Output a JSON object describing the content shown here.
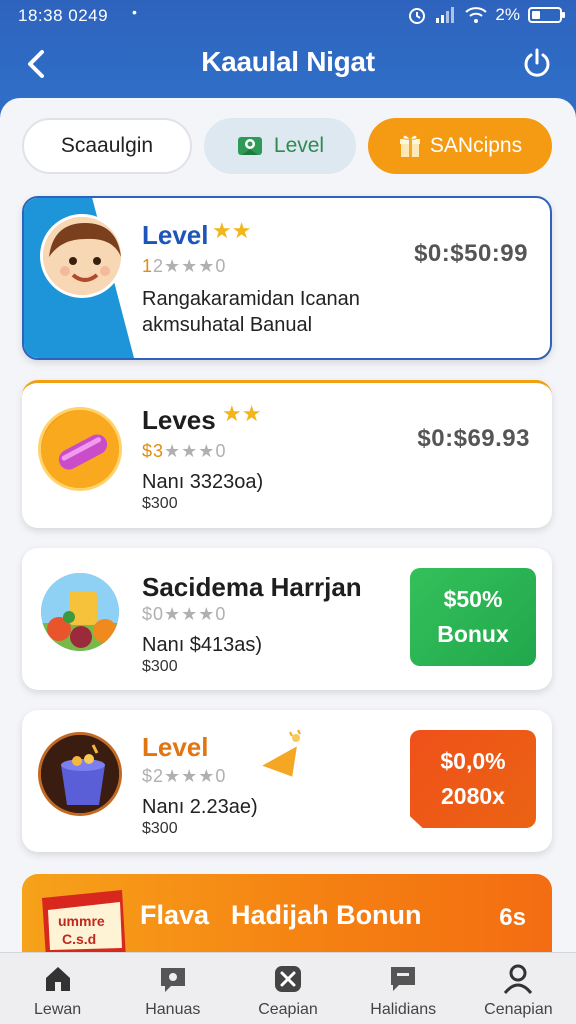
{
  "status_bar": {
    "time": "18:38 0249",
    "dot": "•",
    "battery_percent": "2%",
    "battery_level": 0.3
  },
  "header": {
    "title": "Kaaulal Nigat"
  },
  "chips": [
    {
      "label": "Scaaulgin",
      "selected": true
    },
    {
      "label": "Level",
      "icon": "map-pin-icon"
    },
    {
      "label": "SANcipns",
      "icon": "gift-icon"
    }
  ],
  "cards": [
    {
      "title": "Level",
      "rating_number": "1",
      "rating_text": "2★★★0",
      "price": "$0:$50:99",
      "desc_line1": "Rangakaramidan Icanan",
      "desc_line2": "akmsuhatal Banual",
      "stars": 2
    },
    {
      "title": "Leves",
      "rating_number": "$3",
      "rating_text": "★★★0",
      "price": "$0:$69.93",
      "sub1": "Nanı 3323oa)",
      "sub2": "$300",
      "stars": 2
    },
    {
      "title": "Sacidema Harrjan",
      "rating_text": "$0★★★0",
      "sub1": "Nanı $413as)",
      "sub2": "$300",
      "badge_line1": "$50%",
      "badge_line2": "Bonux"
    },
    {
      "title": "Level",
      "rating_text": "$2★★★0",
      "sub1": "Nanı 2.23ae)",
      "sub2": "$300",
      "badge_line1": "$0,0%",
      "badge_line2": "2080x"
    }
  ],
  "promo": {
    "box_text1": "ummre",
    "box_text2": "C.s.d",
    "text_left": "Flava",
    "text_right": "Hadijah Bonun",
    "count": "6s"
  },
  "bottom_nav": [
    {
      "label": "Lewan",
      "icon": "home-icon"
    },
    {
      "label": "Hanuas",
      "icon": "chat-icon"
    },
    {
      "label": "Ceapian",
      "icon": "shuffle-icon"
    },
    {
      "label": "Halidians",
      "icon": "message-icon"
    },
    {
      "label": "Cenapian",
      "icon": "profile-icon"
    }
  ],
  "colors": {
    "primary": "#2e63bd",
    "accent": "#f59a13",
    "green": "#2bb552",
    "orange": "#ee5a17"
  }
}
